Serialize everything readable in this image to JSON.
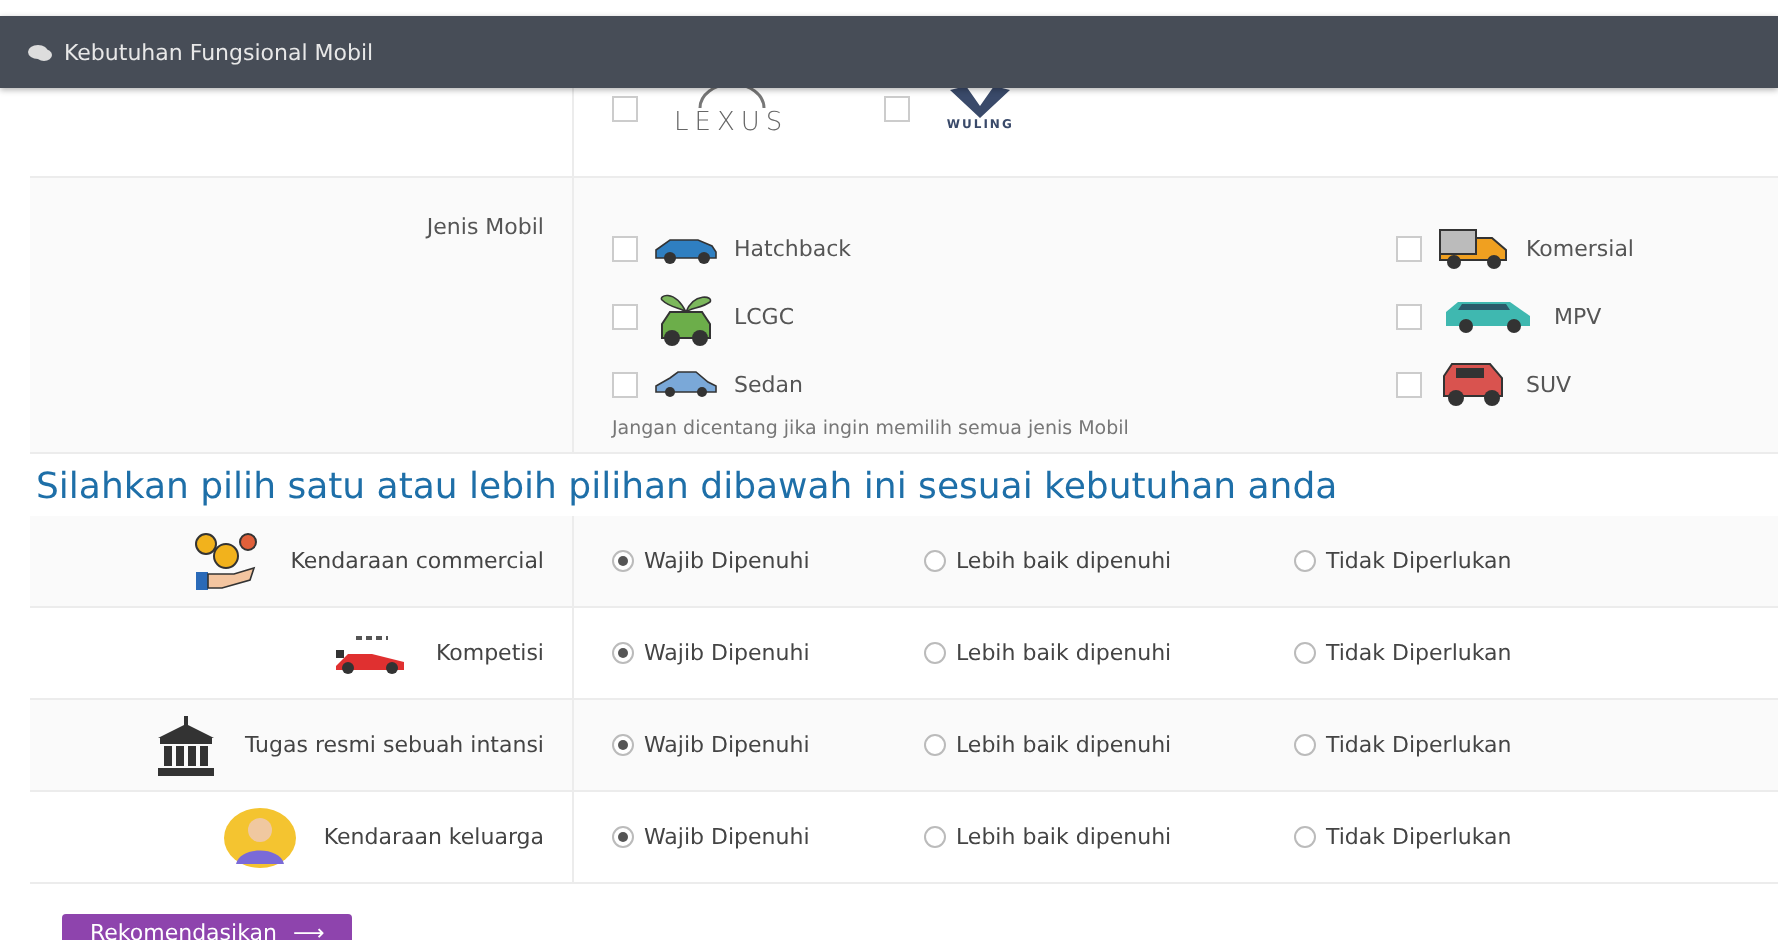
{
  "panel": {
    "title": "Kebutuhan Fungsional Mobil"
  },
  "brands": [
    {
      "kind": "lexus",
      "logo_text": "LEXUS",
      "checked": false
    },
    {
      "kind": "wuling",
      "logo_text": "WULING",
      "checked": false
    }
  ],
  "car_types": {
    "label": "Jenis Mobil",
    "items": [
      {
        "label": "Hatchback",
        "kind": "hatchback",
        "checked": false
      },
      {
        "label": "Komersial",
        "kind": "truck",
        "checked": false
      },
      {
        "label": "LCGC",
        "kind": "eco",
        "checked": false
      },
      {
        "label": "MPV",
        "kind": "mpv",
        "checked": false
      },
      {
        "label": "Sedan",
        "kind": "sedan",
        "checked": false
      },
      {
        "label": "SUV",
        "kind": "suv",
        "checked": false
      }
    ],
    "hint": "Jangan dicentang jika ingin memilih semua jenis Mobil"
  },
  "heading": "Silahkan pilih satu atau lebih pilihan dibawah ini sesuai kebutuhan anda",
  "criteria": [
    {
      "label": "Kendaraan commercial",
      "kind": "money",
      "options": [
        {
          "label": "Wajib Dipenuhi",
          "selected": true
        },
        {
          "label": "Lebih baik dipenuhi",
          "selected": false
        },
        {
          "label": "Tidak Diperlukan",
          "selected": false
        }
      ]
    },
    {
      "label": "Kompetisi",
      "kind": "race",
      "options": [
        {
          "label": "Wajib Dipenuhi",
          "selected": true
        },
        {
          "label": "Lebih baik dipenuhi",
          "selected": false
        },
        {
          "label": "Tidak Diperlukan",
          "selected": false
        }
      ]
    },
    {
      "label": "Tugas resmi sebuah intansi",
      "kind": "building",
      "options": [
        {
          "label": "Wajib Dipenuhi",
          "selected": true
        },
        {
          "label": "Lebih baik dipenuhi",
          "selected": false
        },
        {
          "label": "Tidak Diperlukan",
          "selected": false
        }
      ]
    },
    {
      "label": "Kendaraan keluarga",
      "kind": "family",
      "options": [
        {
          "label": "Wajib Dipenuhi",
          "selected": true
        },
        {
          "label": "Lebih baik dipenuhi",
          "selected": false
        },
        {
          "label": "Tidak Diperlukan",
          "selected": false
        }
      ]
    }
  ],
  "submit": {
    "label": "Rekomendasikan",
    "arrow": "⟶"
  }
}
